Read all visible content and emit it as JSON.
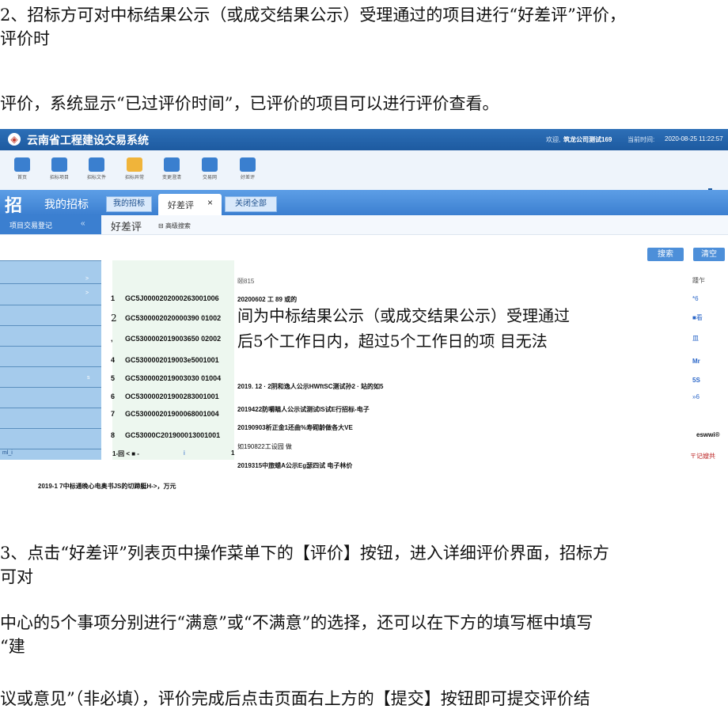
{
  "paragraphs": {
    "p1_line1": "2、招标方可对中标结果公示（或成交结果公示）受理通过的项目进行“好差评”评价，",
    "p1_line2": "评价时",
    "p2": "评价，系统显示“已过评价时间”，已评价的项目可以进行评价查看。",
    "p3_line1": " 3、点击“好差评”列表页中操作菜单下的【评价】按钮，进入详细评价界面，招标方",
    "p3_line2": "可对",
    "p4_line1": " 中心的5个事项分别进行“满意”或“不满意”的选择，还可以在下方的填写框中填写",
    "p4_line2": "“建",
    "p5": " 议或意见”（非必填），评价完成后点击页面右上方的【提交】按钮即可提交评价结"
  },
  "app": {
    "title": "云南省工程建设交易系统",
    "welcome": "欢迎,",
    "username": "筑龙公司测试169",
    "time_label": "当前时间:",
    "time_value": "2020-08-25 11:22:57"
  },
  "toolbar": [
    {
      "label": "首页",
      "icon": "home-icon"
    },
    {
      "label": "招标项目",
      "icon": "chart-icon"
    },
    {
      "label": "招标文件",
      "icon": "document-icon"
    },
    {
      "label": "招标异常",
      "icon": "hand-icon"
    },
    {
      "label": "变更澄清",
      "icon": "edit-icon"
    },
    {
      "label": "交易网",
      "icon": "monitor-icon"
    },
    {
      "label": "好差评",
      "icon": "thumbs-up-icon"
    }
  ],
  "tabs": {
    "section_label": "我的招标",
    "my_bid_btn": "我的招标",
    "active_tab": "好差评",
    "close_symbol": "×",
    "close_all": "关闭全部"
  },
  "subbar": {
    "sidebar_label": "项目交易登记",
    "sidebar_mark": "«",
    "page_label": "好差评",
    "adv_search": "高级搜索"
  },
  "actions": {
    "search": "搜索",
    "clear": "清空"
  },
  "sidebar": {
    "arrow": ">",
    "s_mark": "s",
    "bottom": "ml_i"
  },
  "rows": [
    {
      "num": "1",
      "code": "GC5J0000202000263001006"
    },
    {
      "num": "2",
      "code": "GC5300002020000390 01002"
    },
    {
      "num": ",",
      "code": "GC5300002019003650 02002"
    },
    {
      "num": "4",
      "code": "GC5300002019003e5001001"
    },
    {
      "num": "5",
      "code": "GC5300002019003030 01004"
    },
    {
      "num": "6",
      "code": "OC530000201900283001001"
    },
    {
      "num": "7",
      "code": "GC530000201900068001004"
    },
    {
      "num": "8",
      "code": "GC53000C201900013001001"
    }
  ],
  "pager": {
    "text": "1-回 < ■ -",
    "i": "i",
    "one": "1"
  },
  "middle": {
    "header": "颐815",
    "r1": "20200602 工  89 或的",
    "r5": "2019. 12 · 2阴和逸人公示HWftSC测试孙2 · 站的如5",
    "r6": "2019422防嚼瞄人公示试测试IS试E行招标-电子",
    "r7": "20190903析正金1还曲%寿砌龄做各大VE",
    "r8": "如190822工设园    做",
    "r9": "2019315中旅蜡A公示Eg瑟四试  电子林价",
    "bottom": "2019-1 7中标通晚心电奥书JS的切蹄艇H->，万元"
  },
  "overlay": {
    "line1": "间为中标结果公示（或成交结果公示）受理通过",
    "line2": "后5个工作日内，超过5个工作日的项  目无法"
  },
  "right_col": {
    "header": "踵乍",
    "r1": "*6",
    "r2": "■看",
    "r3": "皿",
    "r4": "Mr",
    "r5": "5S",
    "r6": "»6",
    "r7": "eswwi®",
    "r8": "〒记嫂共"
  },
  "colors": {
    "topbar": "#2d6fb7",
    "tabbar": "#3b7fd0",
    "sidebar": "#a5cbec",
    "codecol": "#edf7ef",
    "link": "#2a66c8"
  }
}
